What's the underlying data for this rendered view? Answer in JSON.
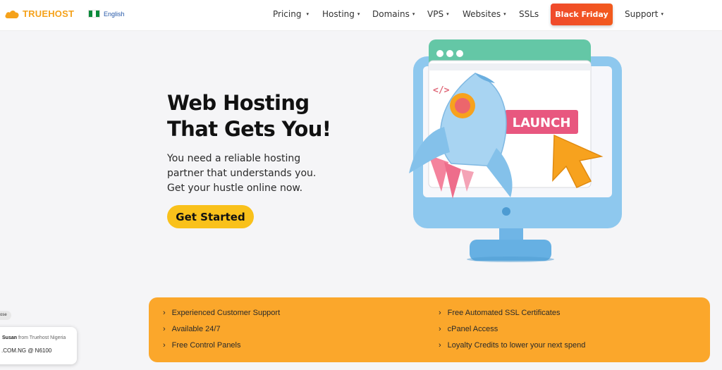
{
  "brand": {
    "name": "TRUEHOST",
    "color": "#f5a21b"
  },
  "language": {
    "label": "English",
    "flag_colors": [
      "#0a8a3a",
      "#ffffff",
      "#0a8a3a"
    ]
  },
  "nav": {
    "items": [
      {
        "label": "Pricing",
        "dropdown": true
      },
      {
        "label": "Hosting",
        "dropdown": true
      },
      {
        "label": "Domains",
        "dropdown": true
      },
      {
        "label": "VPS",
        "dropdown": true
      },
      {
        "label": "Websites",
        "dropdown": true
      },
      {
        "label": "SSLs",
        "dropdown": false
      }
    ],
    "promo_label": "Black Friday",
    "support_label": "Support",
    "caret": "▾"
  },
  "hero": {
    "title_line1": "Web Hosting",
    "title_line2": "That Gets You!",
    "subtitle_line1": "You need a reliable hosting",
    "subtitle_line2": "partner that understands you.",
    "subtitle_line3": "Get your hustle online now.",
    "cta_label": "Get Started",
    "cta_color": "#f9c11b"
  },
  "illustration": {
    "code_glyph": "</>",
    "launch_label": "LAUNCH"
  },
  "features": {
    "color": "#fba72b",
    "chevron": "›",
    "left": [
      "Experienced Customer Support",
      "Available 24/7",
      "Free Control Panels"
    ],
    "right": [
      "Free Automated SSL Certificates",
      "cPanel Access",
      "Loyalty Credits to lower your next spend"
    ]
  },
  "toast": {
    "close_label": "ose",
    "name": "Susan",
    "from_text": "from Truehost Nigeria",
    "purchase": ".COM.NG @ N6100"
  }
}
